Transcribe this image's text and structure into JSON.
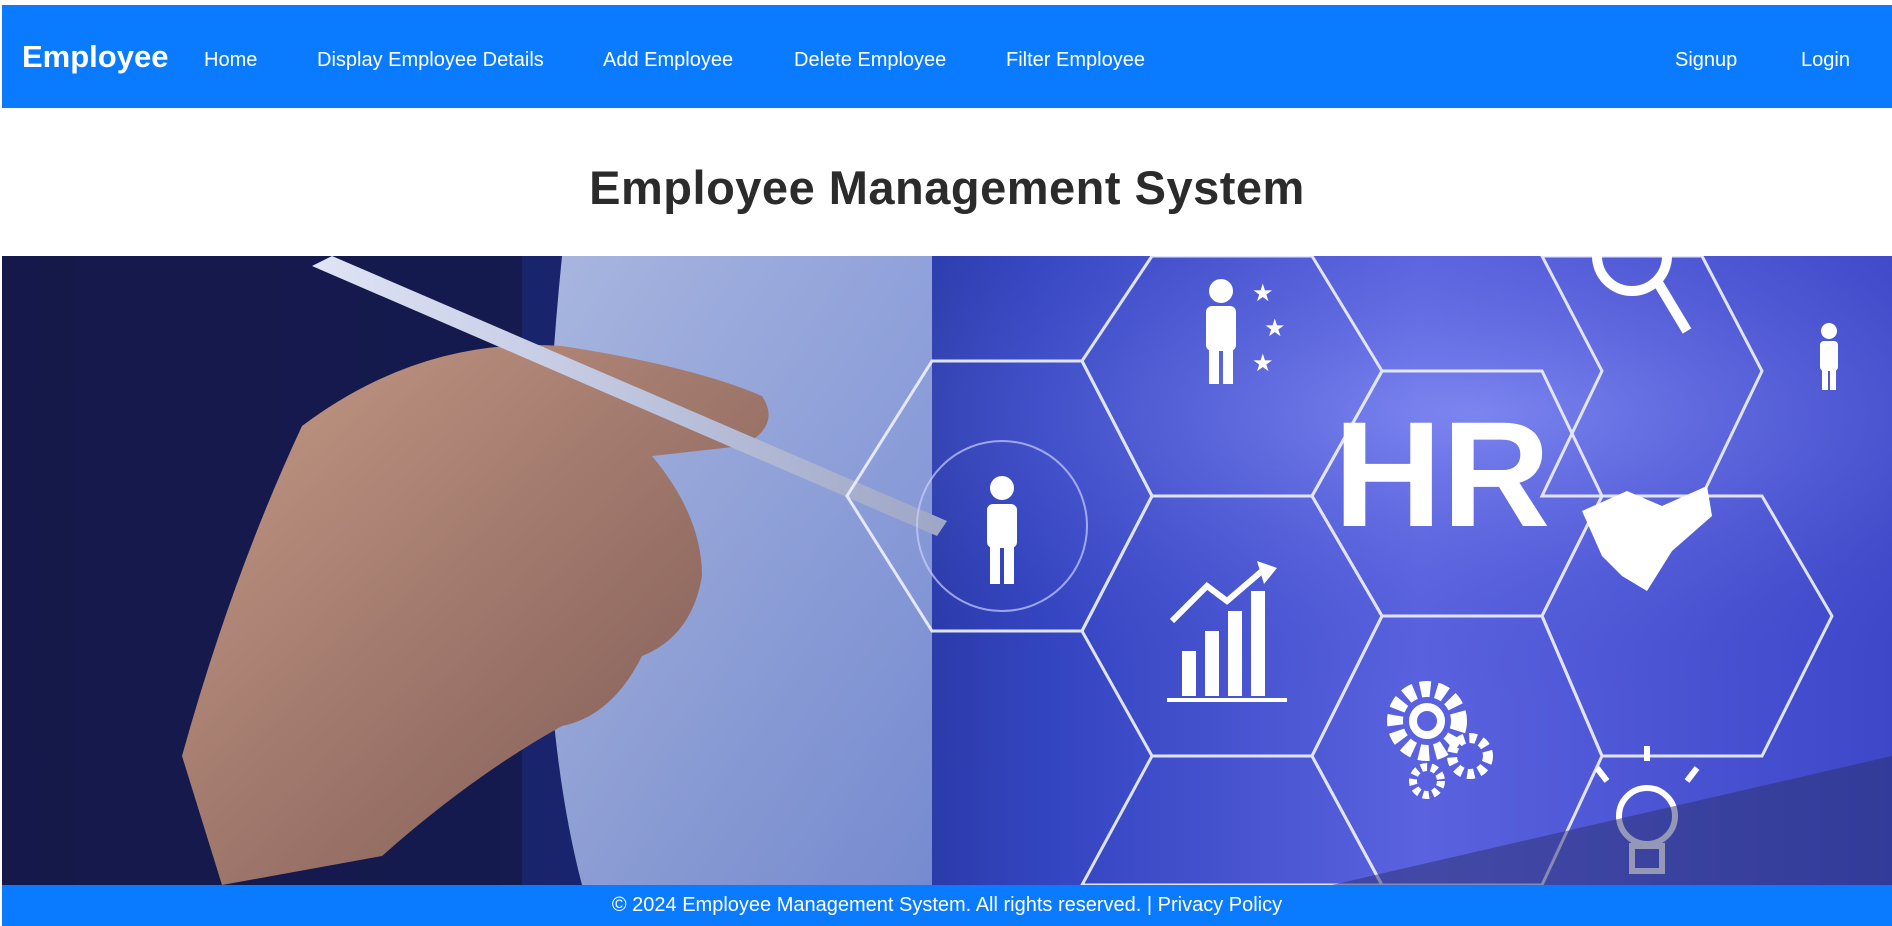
{
  "navbar": {
    "brand": "Employee",
    "links": [
      {
        "label": "Home"
      },
      {
        "label": "Display Employee Details"
      },
      {
        "label": "Add Employee"
      },
      {
        "label": "Delete Employee"
      },
      {
        "label": "Filter Employee"
      }
    ],
    "auth": [
      {
        "label": "Signup"
      },
      {
        "label": "Login"
      }
    ]
  },
  "main": {
    "title": "Employee Management System",
    "hero": {
      "hex_text": "HR",
      "icons": [
        "person-icon",
        "person-stars-icon",
        "magnifier-icon",
        "bar-chart-icon",
        "gears-icon",
        "handshake-icon",
        "lightbulb-icon"
      ]
    }
  },
  "footer": {
    "copyright": "© 2024 Employee Management System. All rights reserved. | ",
    "privacy_link": "Privacy Policy"
  },
  "colors": {
    "primary": "#0a7bff",
    "title": "#2b2b2b"
  }
}
